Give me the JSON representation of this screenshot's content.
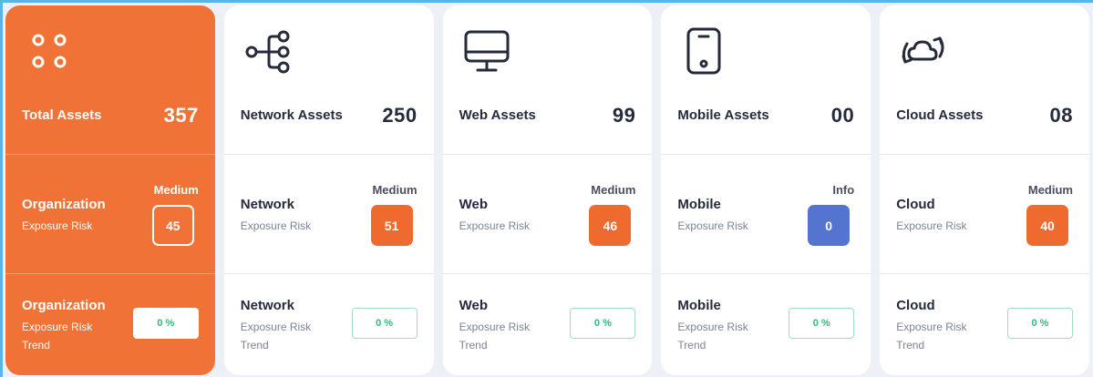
{
  "total": {
    "title": "Total Assets",
    "count": "357",
    "risk_title": "Organization",
    "risk_sub": "Exposure Risk",
    "risk_level": "Medium",
    "risk_score": "45",
    "trend_title": "Organization",
    "trend_sub1": "Exposure Risk",
    "trend_sub2": "Trend",
    "trend_value": "0 %",
    "icon": "grid-dots-icon"
  },
  "cards": [
    {
      "key": "network",
      "title": "Network Assets",
      "count": "250",
      "risk_title": "Network",
      "risk_sub": "Exposure Risk",
      "risk_level": "Medium",
      "risk_score": "51",
      "trend_title": "Network",
      "trend_sub1": "Exposure Risk",
      "trend_sub2": "Trend",
      "trend_value": "0 %",
      "icon": "network-icon"
    },
    {
      "key": "web",
      "title": "Web Assets",
      "count": "99",
      "risk_title": "Web",
      "risk_sub": "Exposure Risk",
      "risk_level": "Medium",
      "risk_score": "46",
      "trend_title": "Web",
      "trend_sub1": "Exposure Risk",
      "trend_sub2": "Trend",
      "trend_value": "0 %",
      "icon": "monitor-icon"
    },
    {
      "key": "mobile",
      "title": "Mobile Assets",
      "count": "00",
      "risk_title": "Mobile",
      "risk_sub": "Exposure Risk",
      "risk_level": "Info",
      "risk_score": "0",
      "trend_title": "Mobile",
      "trend_sub1": "Exposure Risk",
      "trend_sub2": "Trend",
      "trend_value": "0 %",
      "icon": "mobile-phone-icon"
    },
    {
      "key": "cloud",
      "title": "Cloud Assets",
      "count": "08",
      "risk_title": "Cloud",
      "risk_sub": "Exposure Risk",
      "risk_level": "Medium",
      "risk_score": "40",
      "trend_title": "Cloud",
      "trend_sub1": "Exposure Risk",
      "trend_sub2": "Trend",
      "trend_value": "0 %",
      "icon": "cloud-sync-icon"
    }
  ],
  "colors": {
    "accent": "#f07237",
    "medium": "#ef6a2e",
    "info": "#5574cf",
    "trend": "#2dbb7b",
    "text": "#262b3c"
  }
}
